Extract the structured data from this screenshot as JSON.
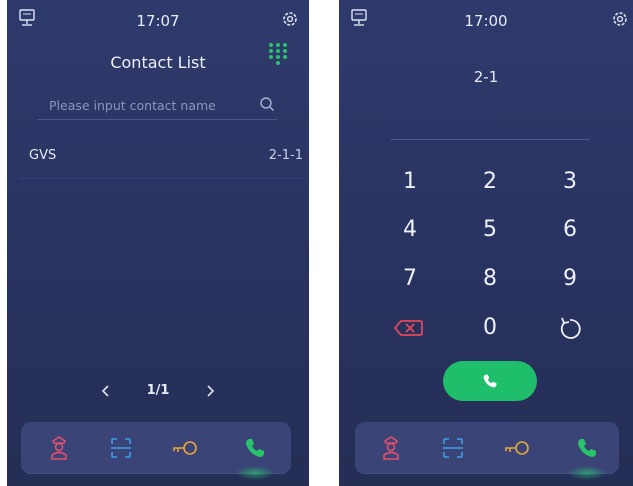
{
  "left_screen": {
    "status": {
      "time": "17:07"
    },
    "title": "Contact List",
    "search": {
      "placeholder": "Please input contact name"
    },
    "contacts": [
      {
        "name": "GVS",
        "number": "2-1-1"
      }
    ],
    "pager": {
      "label": "1/1"
    },
    "dock": [
      "guard-icon",
      "scan-icon",
      "key-icon",
      "phone-icon"
    ]
  },
  "right_screen": {
    "status": {
      "time": "17:00"
    },
    "dial_input": "2-1",
    "keys": [
      "1",
      "2",
      "3",
      "4",
      "5",
      "6",
      "7",
      "8",
      "9",
      "0"
    ],
    "dock": [
      "guard-icon",
      "scan-icon",
      "key-icon",
      "phone-icon"
    ]
  },
  "colors": {
    "background": "#2a3462",
    "accent_green": "#1fbe6a",
    "guard": "#e2506e",
    "scan": "#3aa0e8",
    "key": "#e8a83a",
    "delete": "#e24a5a"
  }
}
